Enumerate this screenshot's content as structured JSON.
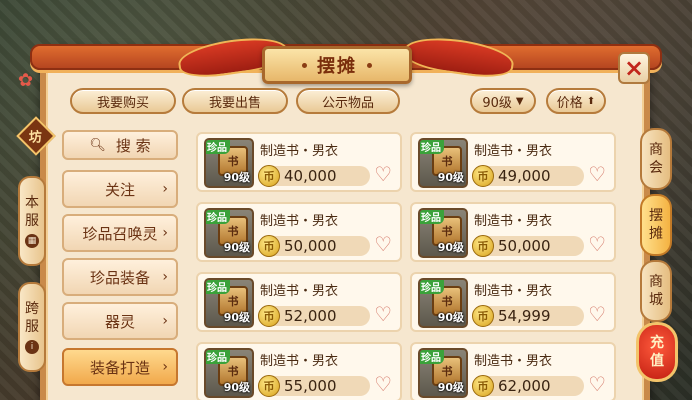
{
  "window": {
    "title": "摆摊",
    "close_icon": "×",
    "fang_label": "坊"
  },
  "top_tabs": [
    {
      "label": "我要购买"
    },
    {
      "label": "我要出售"
    },
    {
      "label": "公示物品"
    }
  ],
  "filters": {
    "level": "90级",
    "price": "价格"
  },
  "left_vtabs": [
    {
      "label": [
        "本",
        "服"
      ]
    },
    {
      "label": [
        "跨",
        "服"
      ]
    }
  ],
  "sidebar": {
    "search_label": "搜  索",
    "items": [
      {
        "label": "关注"
      },
      {
        "label": "珍品召唤灵"
      },
      {
        "label": "珍品装备"
      },
      {
        "label": "器灵"
      },
      {
        "label": "装备打造"
      }
    ]
  },
  "right_tabs": [
    {
      "label": [
        "商",
        "会"
      ]
    },
    {
      "label": [
        "摆",
        "摊"
      ]
    },
    {
      "label": [
        "商",
        "城"
      ]
    }
  ],
  "recharge": [
    "充",
    "值"
  ],
  "items": [
    {
      "name": "制造书・男衣",
      "price": "40,000",
      "rarity": "珍品",
      "level": "90级"
    },
    {
      "name": "制造书・男衣",
      "price": "49,000",
      "rarity": "珍品",
      "level": "90级"
    },
    {
      "name": "制造书・男衣",
      "price": "50,000",
      "rarity": "珍品",
      "level": "90级"
    },
    {
      "name": "制造书・男衣",
      "price": "50,000",
      "rarity": "珍品",
      "level": "90级"
    },
    {
      "name": "制造书・男衣",
      "price": "52,000",
      "rarity": "珍品",
      "level": "90级"
    },
    {
      "name": "制造书・男衣",
      "price": "54,999",
      "rarity": "珍品",
      "level": "90级"
    },
    {
      "name": "制造书・男衣",
      "price": "55,000",
      "rarity": "珍品",
      "level": "90级"
    },
    {
      "name": "制造书・男衣",
      "price": "62,000",
      "rarity": "珍品",
      "level": "90级"
    }
  ],
  "colors": {
    "panel_bg": "#f6e7cf",
    "frame": "#c98a4a",
    "rare_badge": "#3aa23a",
    "active_tab": "#f1a94b"
  }
}
